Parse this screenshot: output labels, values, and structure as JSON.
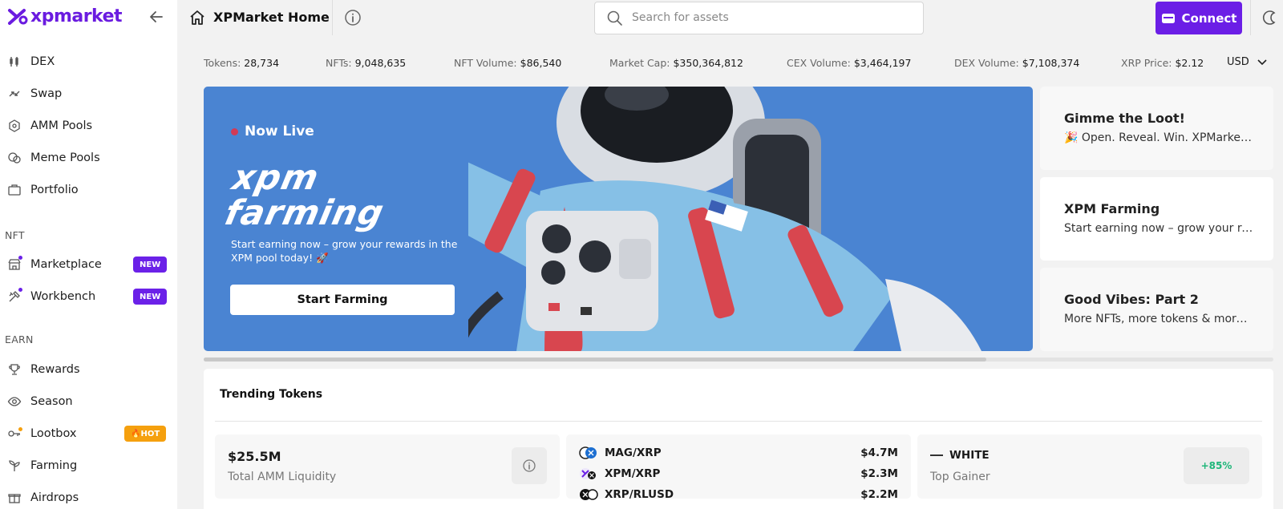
{
  "brand": {
    "name": "xpmarket",
    "accent": "#6b1ee6"
  },
  "sidebar": {
    "items": [
      {
        "label": "DEX",
        "icon": "dex-icon"
      },
      {
        "label": "Swap",
        "icon": "swap-icon"
      },
      {
        "label": "AMM Pools",
        "icon": "amm-pools-icon"
      },
      {
        "label": "Meme Pools",
        "icon": "meme-pools-icon"
      },
      {
        "label": "Portfolio",
        "icon": "portfolio-icon"
      }
    ],
    "nft_section": "NFT",
    "nft_items": [
      {
        "label": "Marketplace",
        "badge": "NEW",
        "icon": "marketplace-icon"
      },
      {
        "label": "Workbench",
        "badge": "NEW",
        "icon": "workbench-icon"
      }
    ],
    "earn_section": "EARN",
    "earn_items": [
      {
        "label": "Rewards",
        "icon": "trophy-icon"
      },
      {
        "label": "Season",
        "icon": "eye-icon"
      },
      {
        "label": "Lootbox",
        "badge": "HOT",
        "icon": "key-icon"
      },
      {
        "label": "Farming",
        "icon": "sprout-icon"
      },
      {
        "label": "Airdrops",
        "icon": "gift-icon"
      }
    ]
  },
  "header": {
    "title": "XPMarket Home",
    "search_placeholder": "Search for assets",
    "connect_label": "Connect"
  },
  "stats": [
    {
      "label": "Tokens:",
      "value": "28,734"
    },
    {
      "label": "NFTs:",
      "value": "9,048,635"
    },
    {
      "label": "NFT Volume:",
      "value": "$86,540"
    },
    {
      "label": "Market Cap:",
      "value": "$350,364,812"
    },
    {
      "label": "CEX Volume:",
      "value": "$3,464,197"
    },
    {
      "label": "DEX Volume:",
      "value": "$7,108,374"
    },
    {
      "label": "XRP Price:",
      "value": "$2.12"
    }
  ],
  "currency": "USD",
  "hero": {
    "live_label": "Now Live",
    "title_line1": "xpm",
    "title_line2": "farming",
    "description": "Start earning now – grow your rewards in the XPM pool today! 🚀",
    "button": "Start Farming"
  },
  "side_cards": [
    {
      "title": "Gimme the Loot!",
      "desc": "🎉 Open. Reveal. Win. XPMarket Lootbox"
    },
    {
      "title": "XPM Farming",
      "desc": "Start earning now – grow your rewards"
    },
    {
      "title": "Good Vibes: Part 2",
      "desc": "More NFTs, more tokens & more vibes"
    }
  ],
  "trending": {
    "title": "Trending Tokens",
    "liquidity_value": "$25.5M",
    "liquidity_label": "Total AMM Liquidity",
    "pairs": [
      {
        "name": "MAG/XRP",
        "value": "$4.7M"
      },
      {
        "name": "XPM/XRP",
        "value": "$2.3M"
      },
      {
        "name": "XRP/RLUSD",
        "value": "$2.2M"
      }
    ],
    "gainer_name": "WHITE",
    "gainer_label": "Top Gainer",
    "gainer_change": "+85%"
  }
}
